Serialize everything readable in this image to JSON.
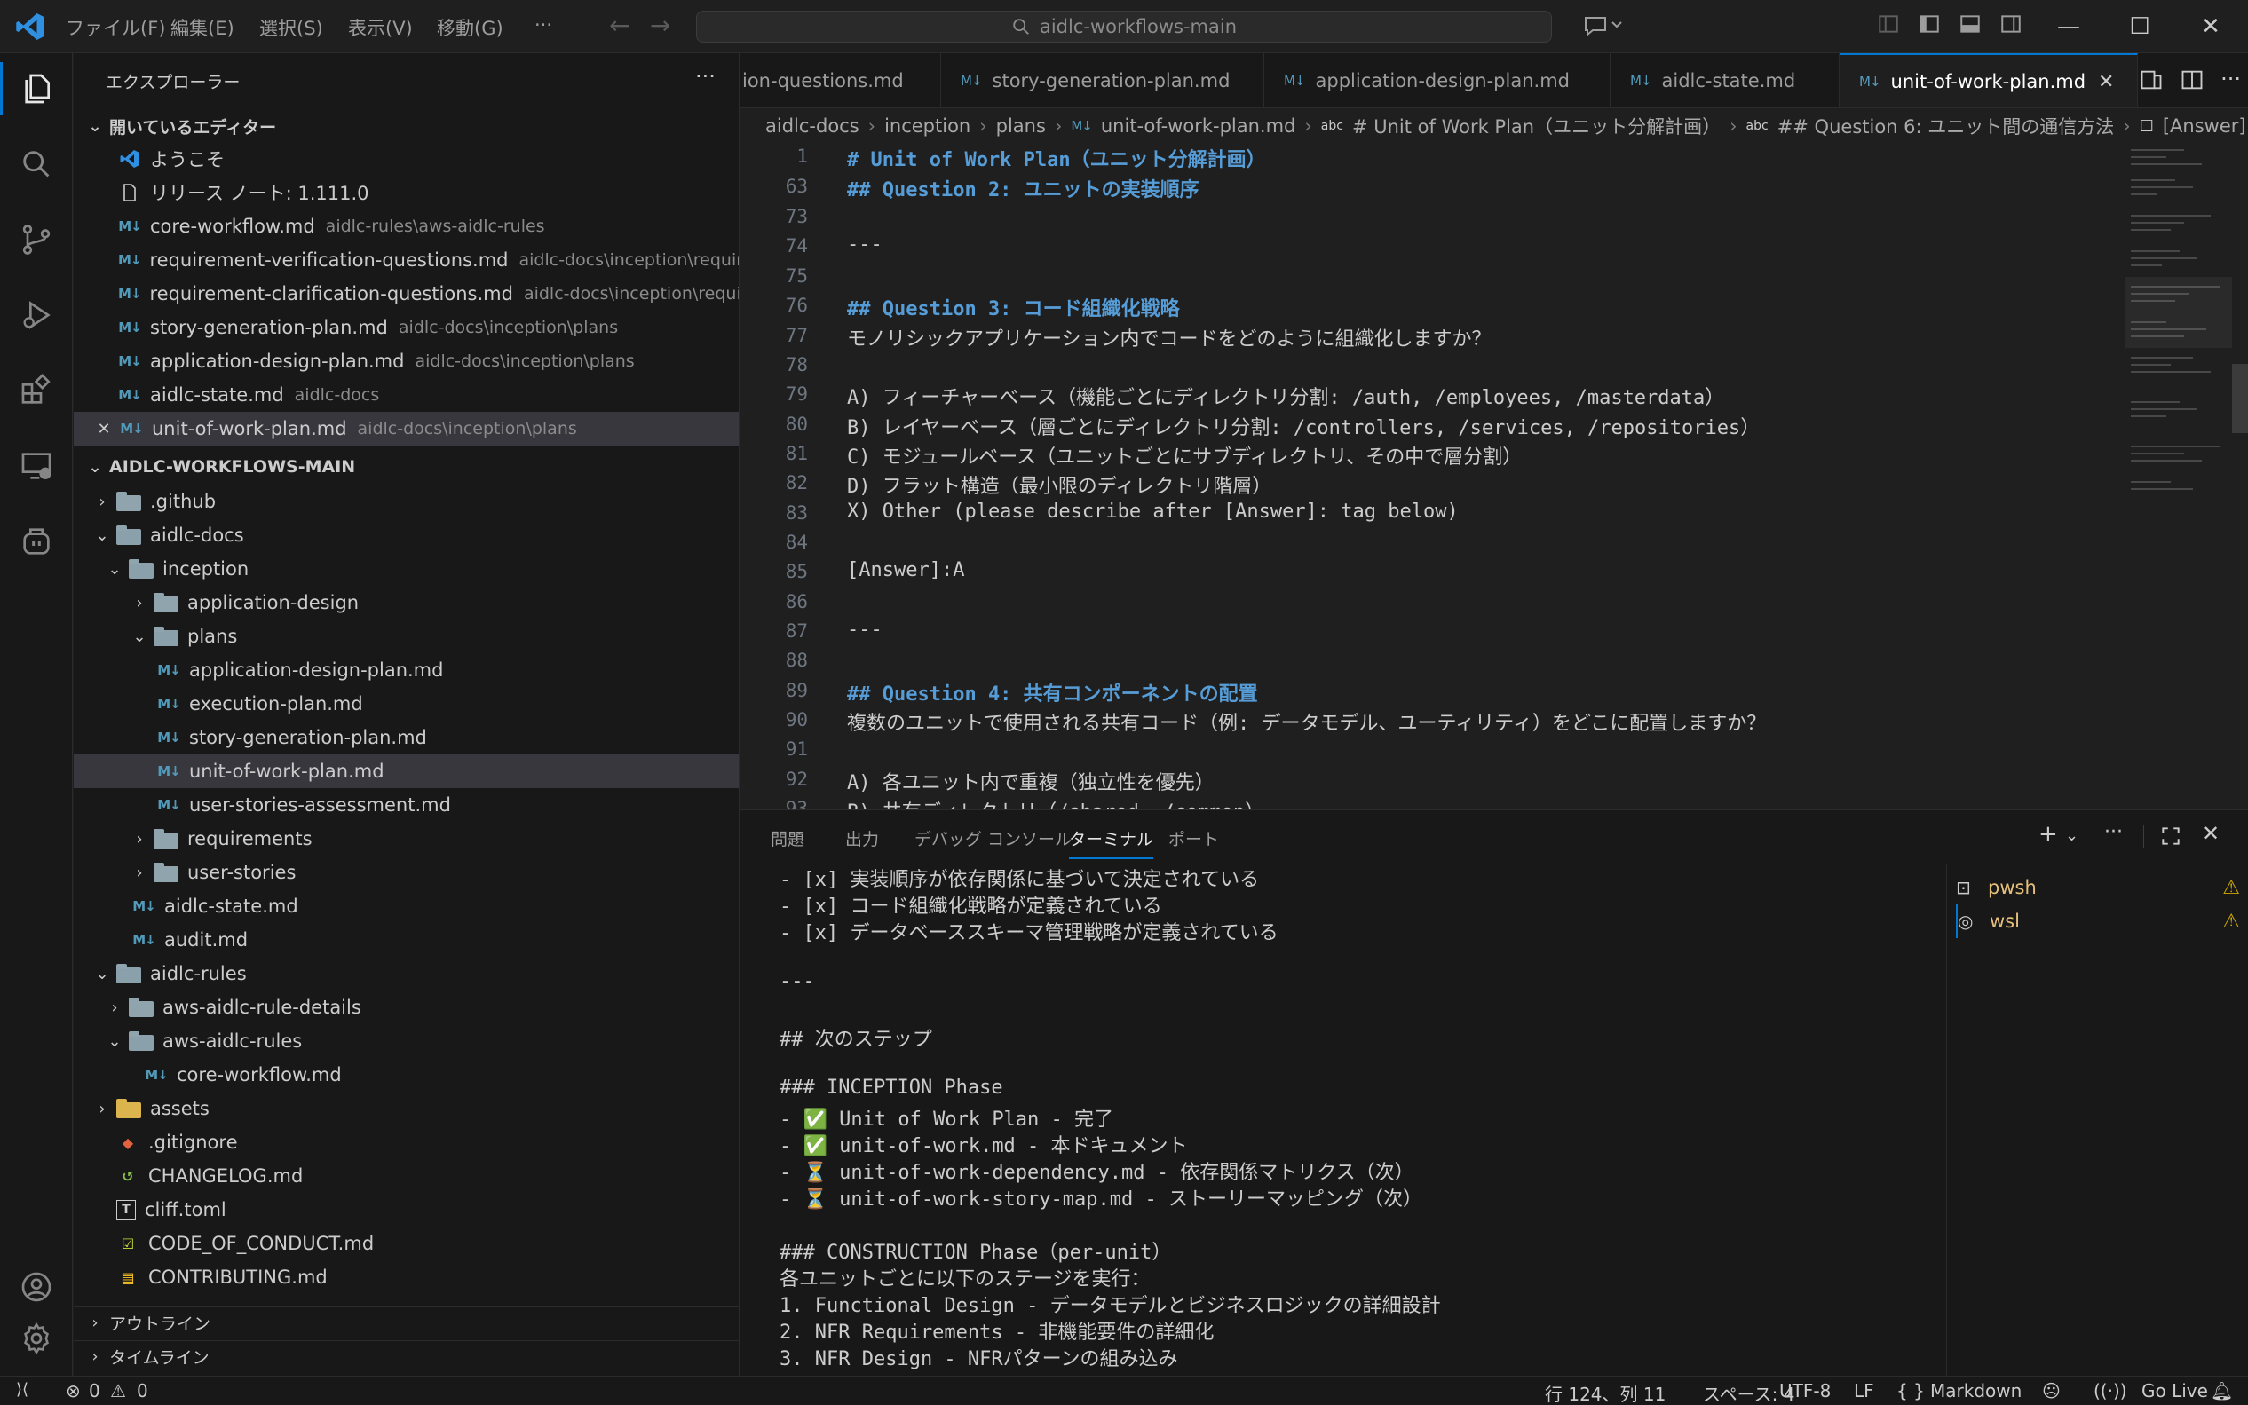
{
  "titlebar": {
    "menu": [
      "ファイル(F)",
      "編集(E)",
      "選択(S)",
      "表示(V)",
      "移動(G)",
      "···"
    ],
    "search_text": "aidlc-workflows-main"
  },
  "sidebar": {
    "title": "エクスプローラー",
    "open_editors_header": "開いているエディター",
    "open_editors": [
      {
        "name": "ようこそ",
        "path": ""
      },
      {
        "name": "リリース ノート: 1.111.0",
        "path": ""
      },
      {
        "name": "core-workflow.md",
        "path": "aidlc-rules\\aws-aidlc-rules"
      },
      {
        "name": "requirement-verification-questions.md",
        "path": "aidlc-docs\\inception\\requir..."
      },
      {
        "name": "requirement-clarification-questions.md",
        "path": "aidlc-docs\\inception\\requi..."
      },
      {
        "name": "story-generation-plan.md",
        "path": "aidlc-docs\\inception\\plans"
      },
      {
        "name": "application-design-plan.md",
        "path": "aidlc-docs\\inception\\plans"
      },
      {
        "name": "aidlc-state.md",
        "path": "aidlc-docs"
      },
      {
        "name": "unit-of-work-plan.md",
        "path": "aidlc-docs\\inception\\plans"
      }
    ],
    "workspace_header": "AIDLC-WORKFLOWS-MAIN",
    "tree": [
      ".github",
      "aidlc-docs",
      "inception",
      "application-design",
      "plans",
      "application-design-plan.md",
      "execution-plan.md",
      "story-generation-plan.md",
      "unit-of-work-plan.md",
      "user-stories-assessment.md",
      "requirements",
      "user-stories",
      "aidlc-state.md",
      "audit.md",
      "aidlc-rules",
      "aws-aidlc-rule-details",
      "aws-aidlc-rules",
      "core-workflow.md",
      "assets",
      ".gitignore",
      "CHANGELOG.md",
      "cliff.toml",
      "CODE_OF_CONDUCT.md",
      "CONTRIBUTING.md"
    ],
    "outline": "アウトライン",
    "timeline": "タイムライン"
  },
  "tabs": [
    "ion-questions.md",
    "story-generation-plan.md",
    "application-design-plan.md",
    "aidlc-state.md",
    "unit-of-work-plan.md"
  ],
  "breadcrumb": [
    "aidlc-docs",
    "inception",
    "plans",
    "unit-of-work-plan.md",
    "# Unit of Work Plan（ユニット分解計画）",
    "## Question 6: ユニット間の通信方法",
    "[Answer]"
  ],
  "editor": {
    "lines": [
      {
        "n": "1",
        "t": "# Unit of Work Plan（ユニット分解計画）"
      },
      {
        "n": "63",
        "t": "## Question 2: ユニットの実装順序"
      },
      {
        "n": "73",
        "t": ""
      },
      {
        "n": "74",
        "t": "---"
      },
      {
        "n": "75",
        "t": ""
      },
      {
        "n": "76",
        "t": "## Question 3: コード組織化戦略"
      },
      {
        "n": "77",
        "t": "モノリシックアプリケーション内でコードをどのように組織化しますか？"
      },
      {
        "n": "78",
        "t": ""
      },
      {
        "n": "79",
        "t": "A) フィーチャーベース（機能ごとにディレクトリ分割: /auth, /employees, /masterdata）"
      },
      {
        "n": "80",
        "t": "B) レイヤーベース（層ごとにディレクトリ分割: /controllers, /services, /repositories）"
      },
      {
        "n": "81",
        "t": "C) モジュールベース（ユニットごとにサブディレクトリ、その中で層分割）"
      },
      {
        "n": "82",
        "t": "D) フラット構造（最小限のディレクトリ階層）"
      },
      {
        "n": "83",
        "t": "X) Other (please describe after [Answer]: tag below)"
      },
      {
        "n": "84",
        "t": ""
      },
      {
        "n": "85",
        "t": "[Answer]:A"
      },
      {
        "n": "86",
        "t": ""
      },
      {
        "n": "87",
        "t": "---"
      },
      {
        "n": "88",
        "t": ""
      },
      {
        "n": "89",
        "t": "## Question 4: 共有コンポーネントの配置"
      },
      {
        "n": "90",
        "t": "複数のユニットで使用される共有コード（例: データモデル、ユーティリティ）をどこに配置しますか？"
      },
      {
        "n": "91",
        "t": ""
      },
      {
        "n": "92",
        "t": "A) 各ユニット内で重複（独立性を優先）"
      },
      {
        "n": "93",
        "t": "B) 共有ディレクトリ（/shared, /common）"
      }
    ]
  },
  "panel": {
    "tabs": [
      "問題",
      "出力",
      "デバッグ コンソール",
      "ターミナル",
      "ポート"
    ],
    "terminal_lines": [
      "- [x] 実装順序が依存関係に基づいて決定されている",
      "- [x] コード組織化戦略が定義されている",
      "- [x] データベーススキーマ管理戦略が定義されている",
      "",
      "---",
      "",
      "## 次のステップ",
      "",
      "### INCEPTION Phase",
      "- ✅ Unit of Work Plan - 完了",
      "- ✅ unit-of-work.md - 本ドキュメント",
      "- ⏳ unit-of-work-dependency.md - 依存関係マトリクス（次）",
      "- ⏳ unit-of-work-story-map.md - ストーリーマッピング（次）",
      "",
      "### CONSTRUCTION Phase（per-unit）",
      "各ユニットごとに以下のステージを実行：",
      "1. Functional Design - データモデルとビジネスロジックの詳細設計",
      "2. NFR Requirements - 非機能要件の詳細化",
      "3. NFR Design - NFRパターンの組み込み"
    ],
    "terminals": [
      "pwsh",
      "wsl"
    ]
  },
  "statusbar": {
    "errors": "0",
    "warnings": "0",
    "position": "行 124、列 11",
    "spaces": "スペース: 4",
    "encoding": "UTF-8",
    "eol": "LF",
    "language": "Markdown",
    "golive": "Go Live"
  }
}
